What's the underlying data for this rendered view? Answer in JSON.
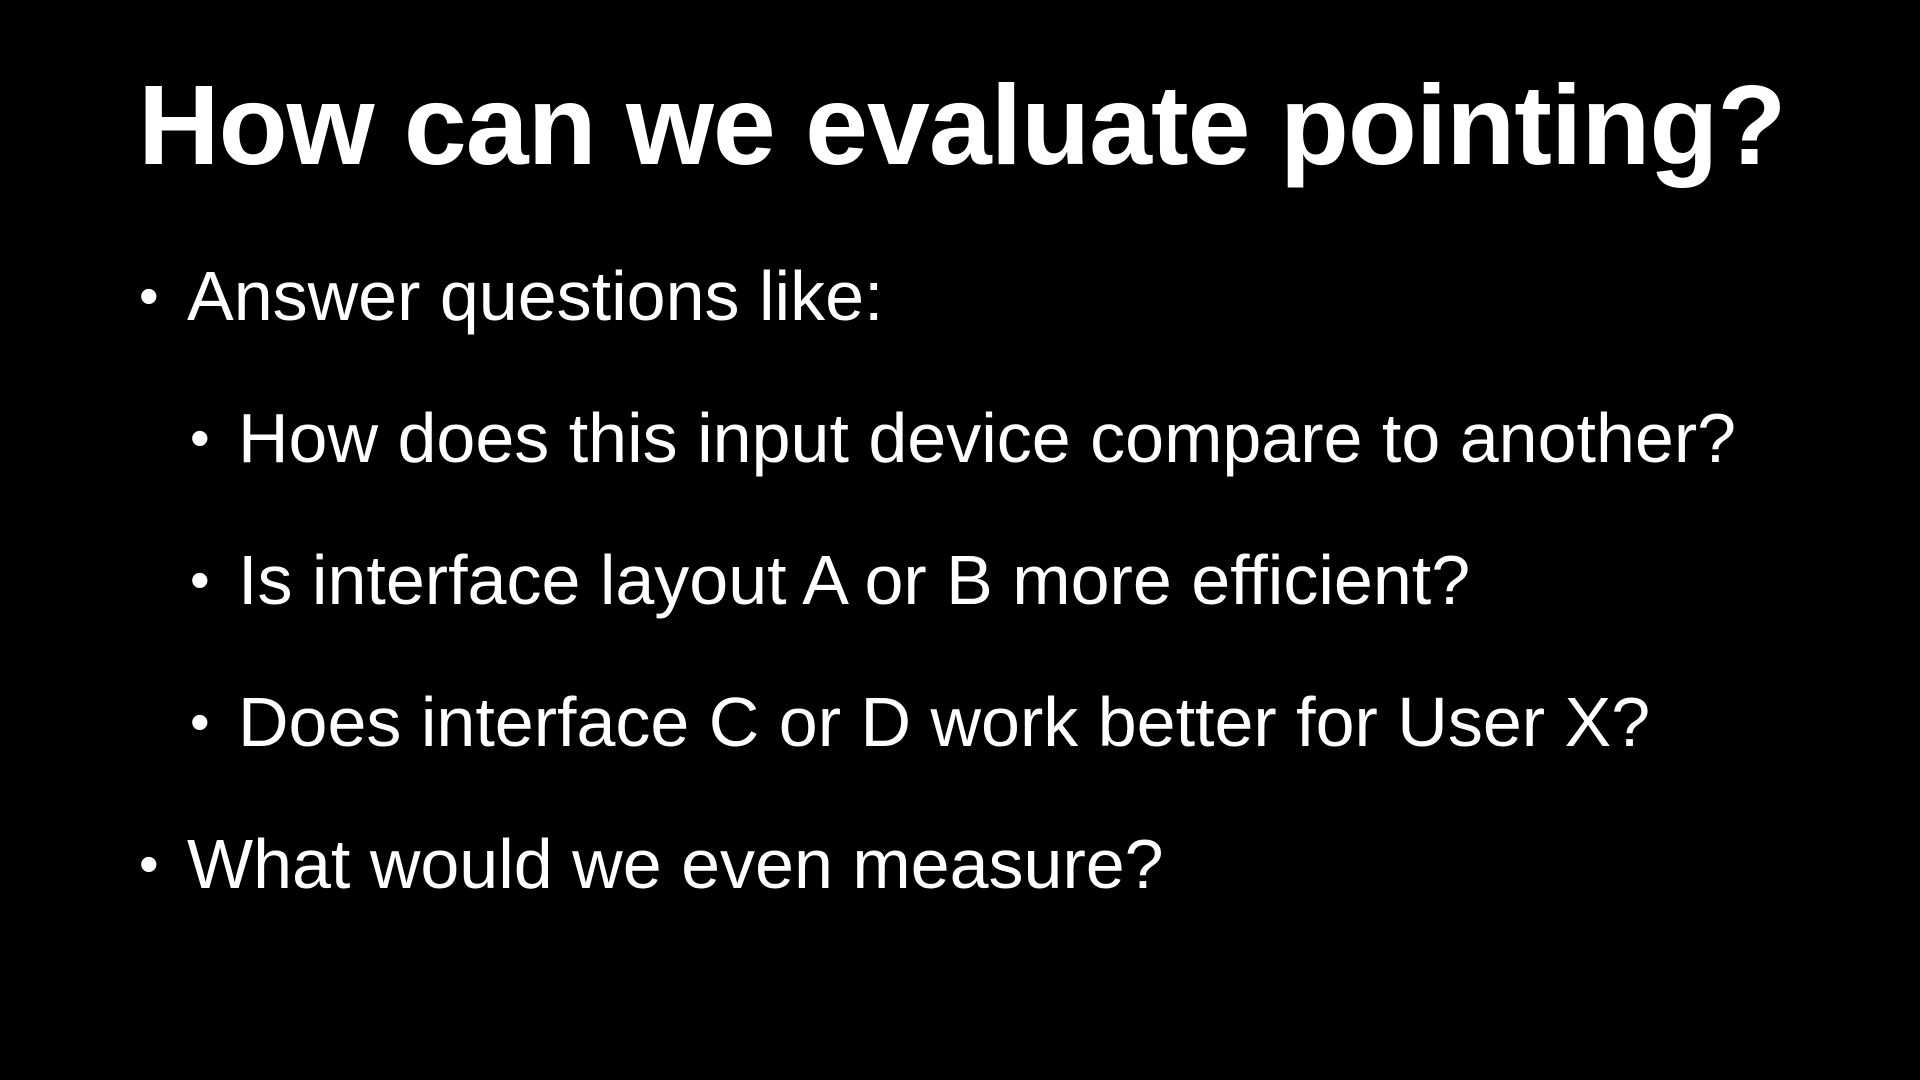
{
  "slide": {
    "title": "How can we evaluate pointing?",
    "bullet_glyph": "•",
    "bullets": [
      {
        "level": 1,
        "text": "Answer questions like:"
      },
      {
        "level": 2,
        "text": "How does this input device compare to another?"
      },
      {
        "level": 2,
        "text": "Is interface layout A or B more efficient?"
      },
      {
        "level": 2,
        "text": "Does interface C or D work better for User X?"
      },
      {
        "level": 1,
        "text": "What would we even measure?"
      }
    ],
    "colors": {
      "background": "#000000",
      "text": "#ffffff"
    }
  }
}
